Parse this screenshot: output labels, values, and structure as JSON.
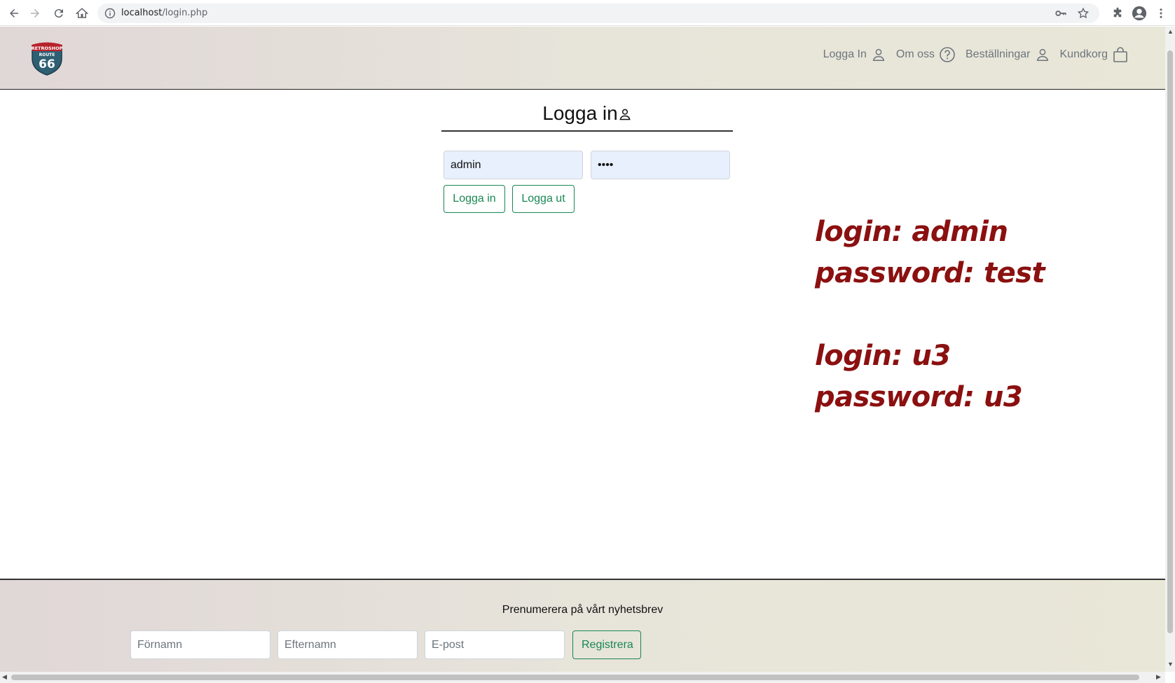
{
  "browser": {
    "url_host": "localhost",
    "url_path": "/login.php"
  },
  "header": {
    "nav": [
      {
        "label": "Logga In",
        "icon": "person-icon"
      },
      {
        "label": "Om oss",
        "icon": "question-circle-icon"
      },
      {
        "label": "Beställningar",
        "icon": "person-icon"
      },
      {
        "label": "Kundkorg",
        "icon": "shopping-bag-icon"
      }
    ]
  },
  "login": {
    "title": "Logga in",
    "username_value": "admin",
    "password_value": "test",
    "login_button": "Logga in",
    "logout_button": "Logga ut"
  },
  "notes": {
    "line1": "login: admin",
    "line2": "password: test",
    "line3": "login: u3",
    "line4": "password: u3"
  },
  "footer": {
    "newsletter_title": "Prenumerera på vårt nyhetsbrev",
    "firstname_placeholder": "Förnamn",
    "lastname_placeholder": "Efternamn",
    "email_placeholder": "E-post",
    "register_button": "Registrera"
  },
  "colors": {
    "accent": "#198754",
    "note": "#8b1010"
  }
}
